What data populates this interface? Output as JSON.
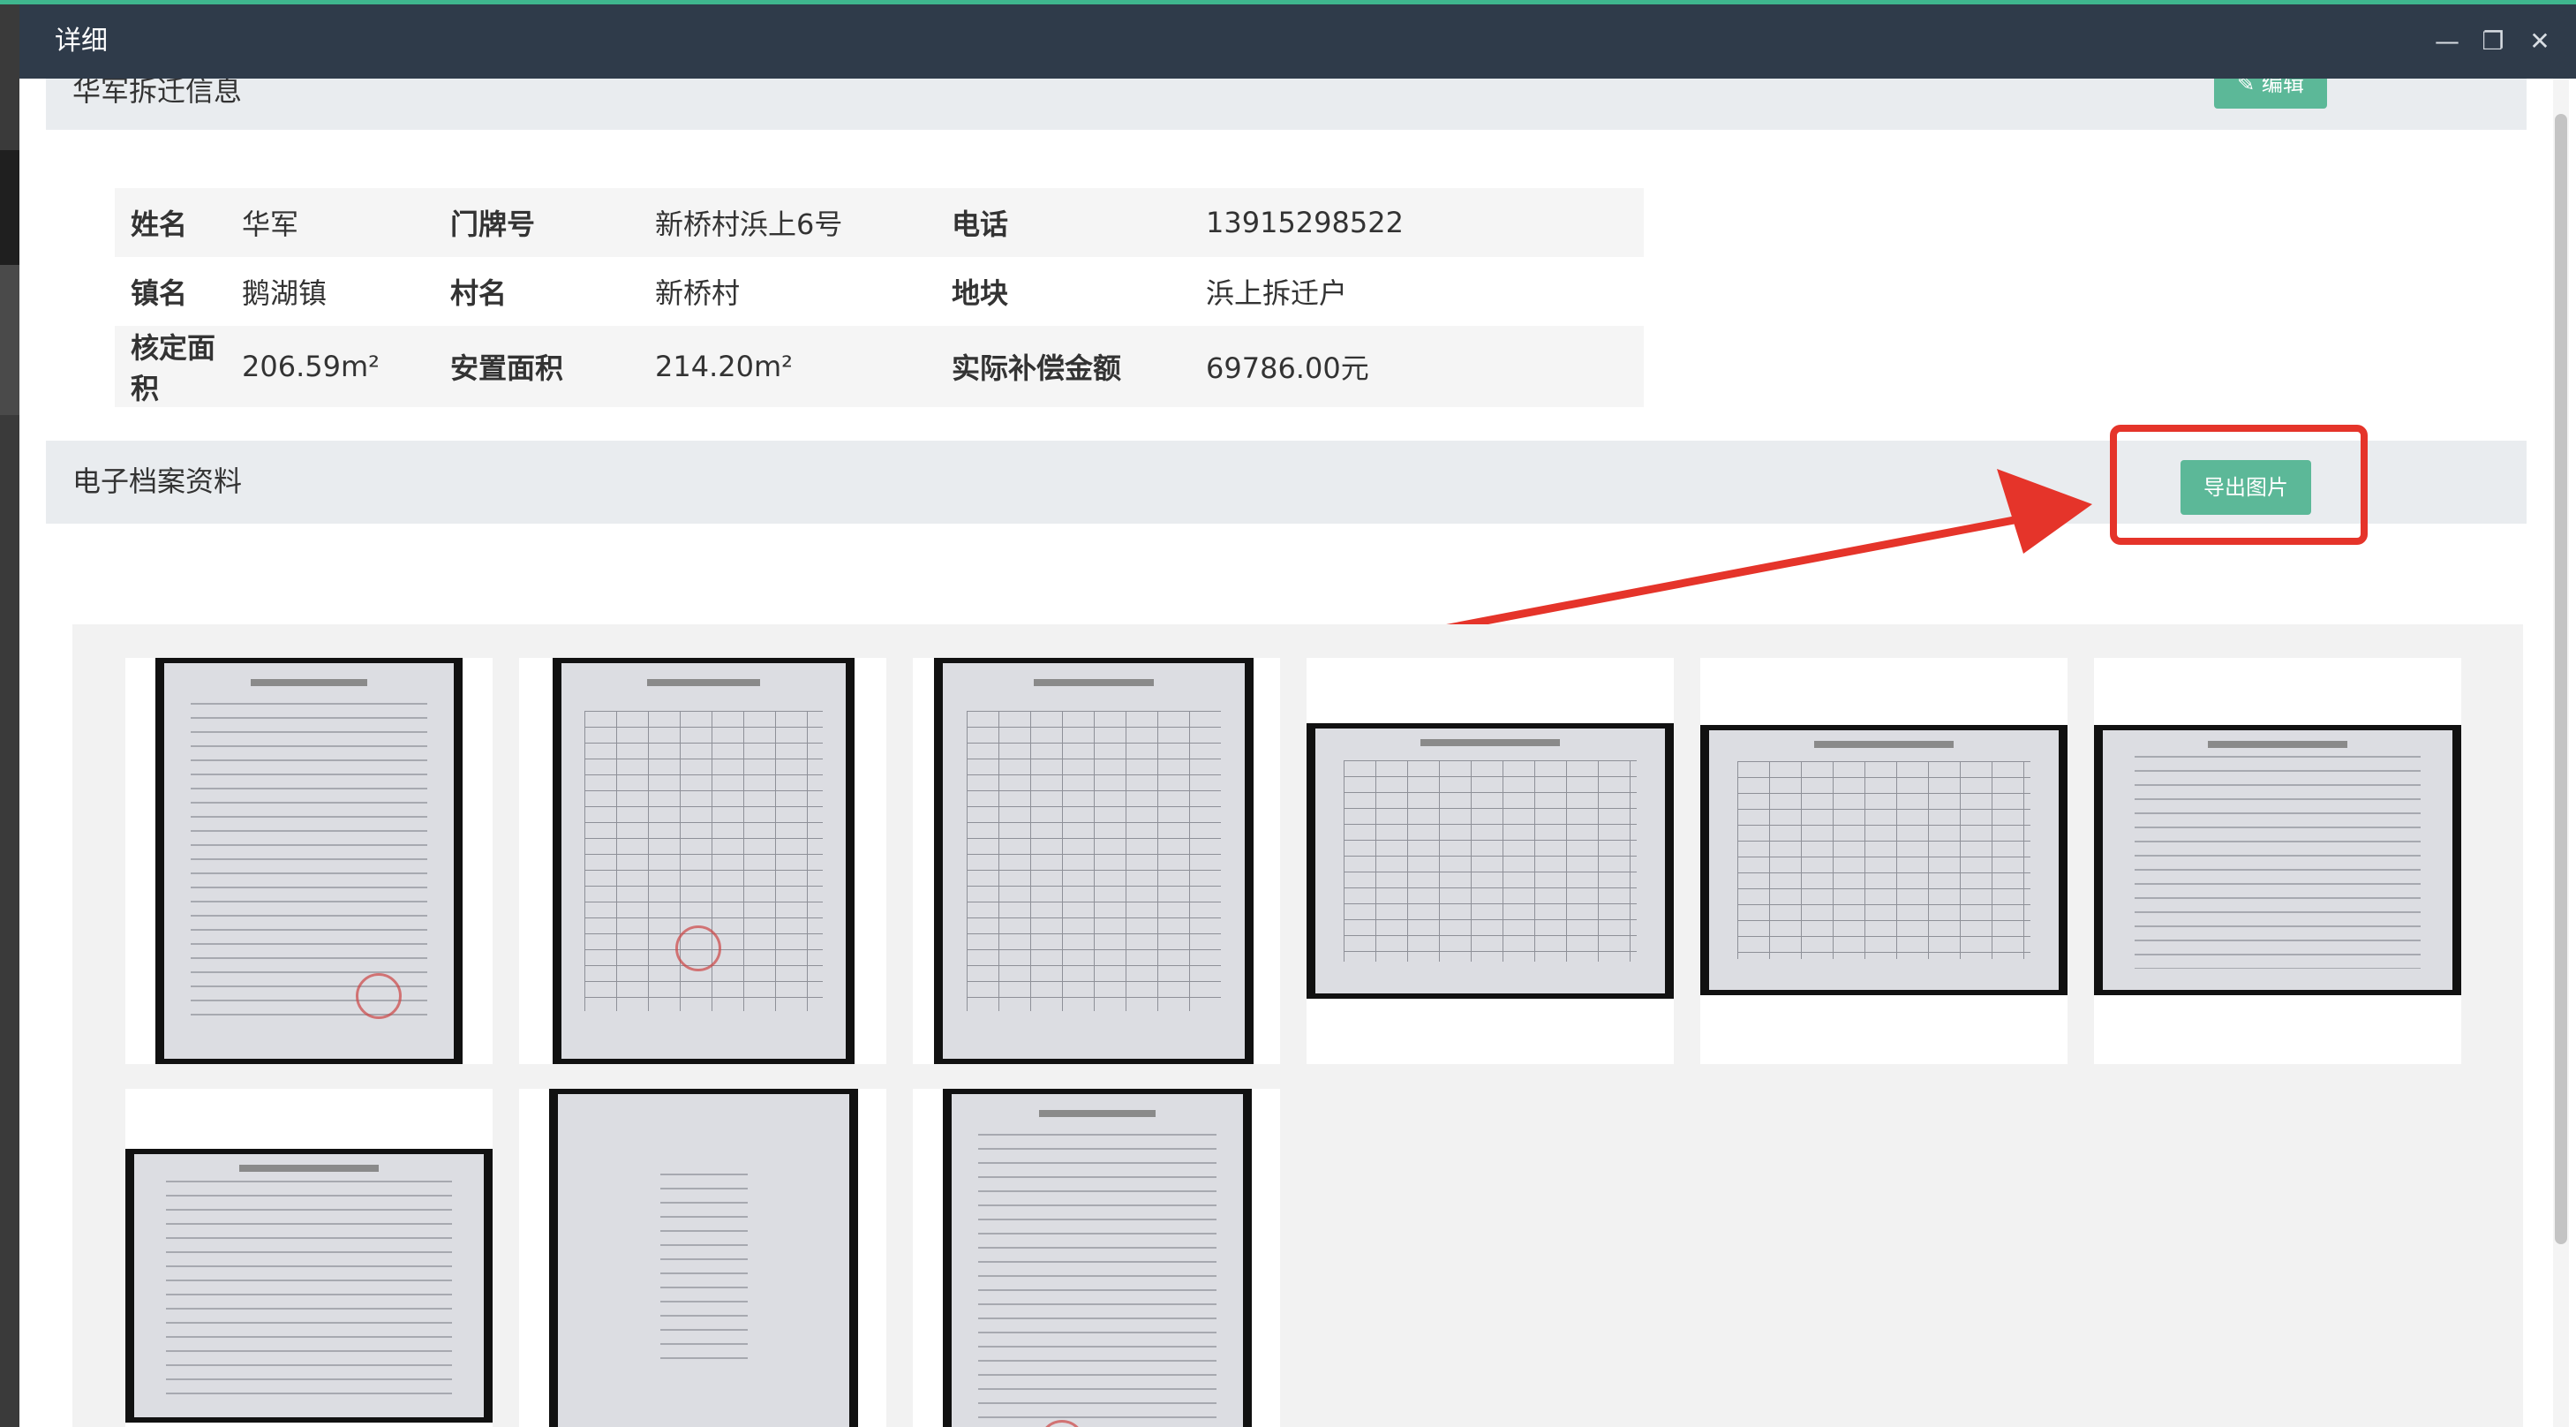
{
  "window": {
    "title": "详细",
    "controls": [
      "minimize",
      "restore",
      "close"
    ]
  },
  "section_info": {
    "header": "华军拆迁信息",
    "edit_button": "✎ 编辑",
    "rows": [
      [
        {
          "k": "姓名",
          "v": "华军"
        },
        {
          "k": "门牌号",
          "v": "新桥村浜上6号"
        },
        {
          "k": "电话",
          "v": "13915298522"
        }
      ],
      [
        {
          "k": "镇名",
          "v": "鹅湖镇"
        },
        {
          "k": "村名",
          "v": "新桥村"
        },
        {
          "k": "地块",
          "v": "浜上拆迁户"
        }
      ],
      [
        {
          "k": "核定面积",
          "v": "206.59m²"
        },
        {
          "k": "安置面积",
          "v": "214.20m²"
        },
        {
          "k": "实际补偿金额",
          "v": "69786.00元"
        }
      ]
    ]
  },
  "section_archive": {
    "header": "电子档案资料",
    "export_button": "导出图片"
  },
  "annotation": {
    "color": "#e5342a"
  },
  "gallery": {
    "count_visible": 9
  },
  "colors": {
    "titlebar": "#2f3b4a",
    "button_green": "#5cb898",
    "section_bg": "#e9ecef"
  }
}
